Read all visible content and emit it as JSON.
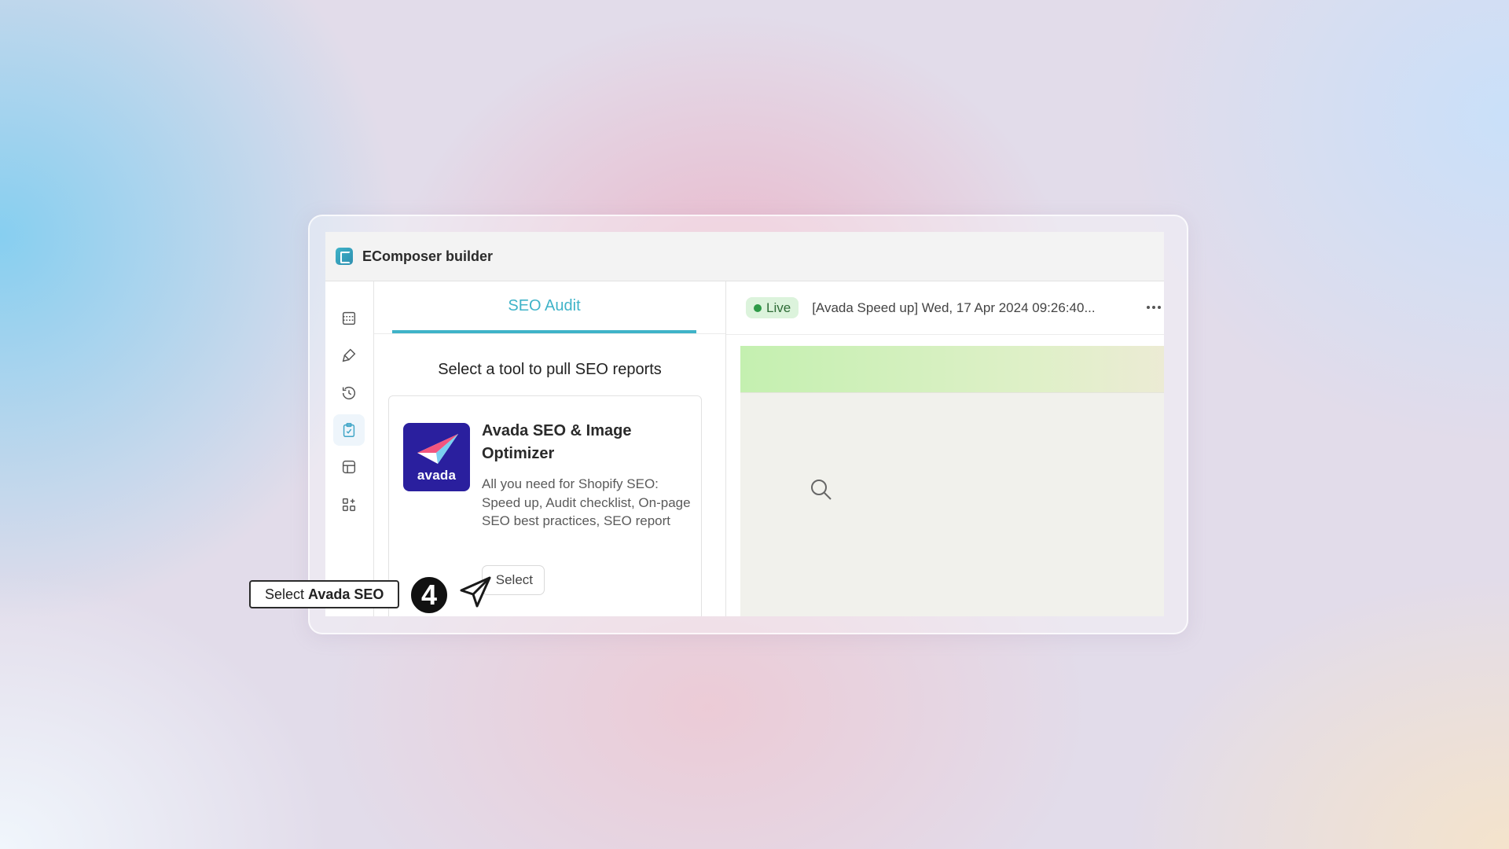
{
  "app": {
    "title": "EComposer builder"
  },
  "rail": {
    "icons": [
      "sections-icon",
      "brush-icon",
      "history-icon",
      "seo-audit-icon",
      "layout-icon",
      "apps-icon"
    ]
  },
  "panel": {
    "tab": "SEO Audit",
    "heading": "Select a tool to pull SEO reports",
    "card": {
      "logo_text": "avada",
      "title": "Avada SEO & Image Optimizer",
      "description": "All you need for Shopify SEO: Speed up, Audit checklist, On-page SEO best practices, SEO report",
      "button": "Select"
    }
  },
  "preview": {
    "status": "Live",
    "title": "[Avada Speed up] Wed, 17 Apr 2024 09:26:40..."
  },
  "tutorial": {
    "callout_prefix": "Select",
    "callout_bold": "Avada SEO",
    "step": "4"
  },
  "colors": {
    "accent": "#3fb3c8",
    "live_bg": "#dcf3dc",
    "avada_bg": "#2a1f9e"
  }
}
